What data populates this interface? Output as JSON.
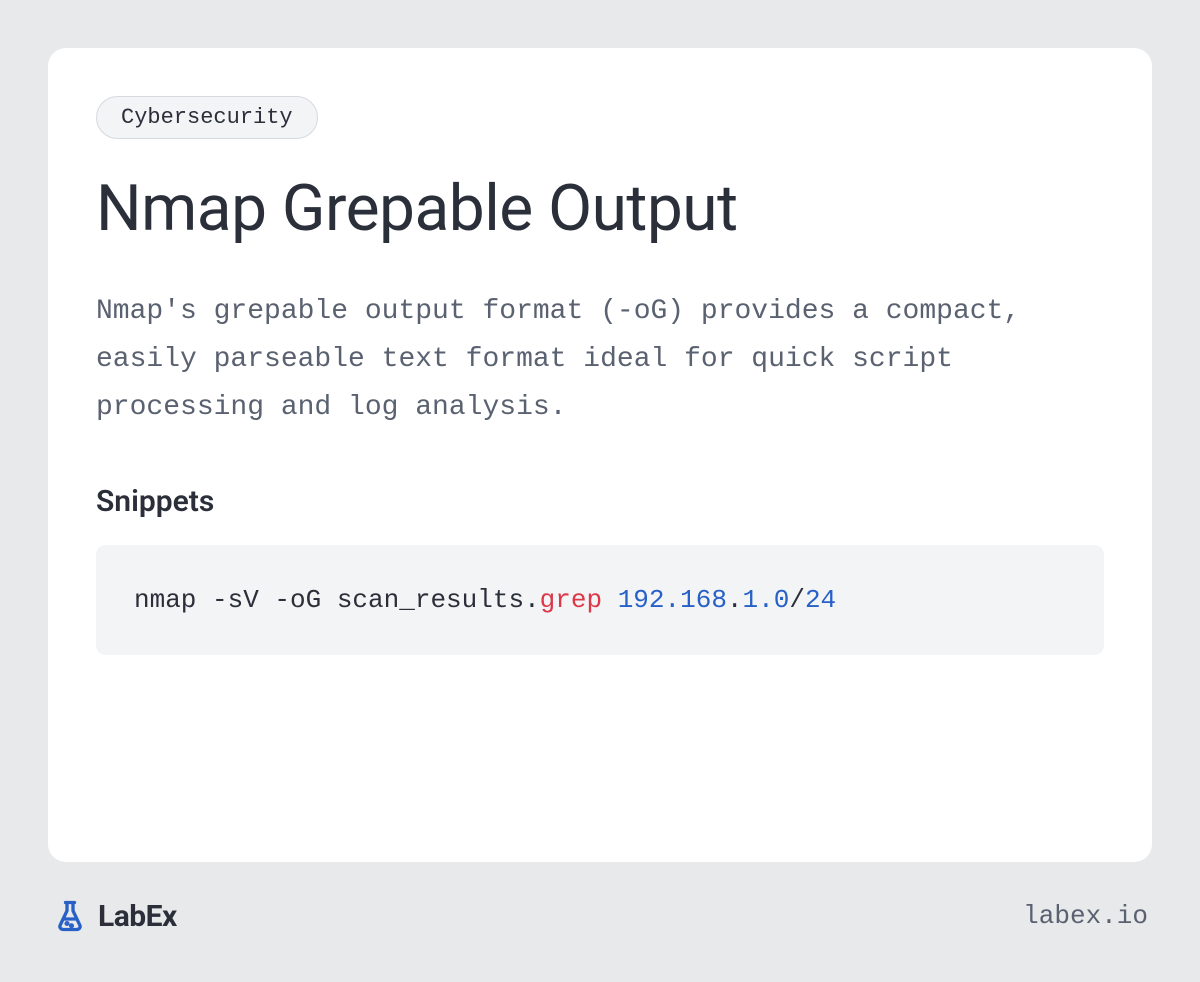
{
  "tag": "Cybersecurity",
  "title": "Nmap Grepable Output",
  "description": "Nmap's grepable output format (-oG) provides a compact, easily parseable text format ideal for quick script processing and log analysis.",
  "snippets_heading": "Snippets",
  "code": {
    "part1": "nmap -sV -oG scan_results.",
    "part2_red": "grep",
    "part3": " ",
    "part4_blue1": "192.168",
    "part5": ".",
    "part6_blue2": "1.0",
    "part7": "/",
    "part8_blue3": "24"
  },
  "brand": {
    "name": "LabEx",
    "url": "labex.io"
  }
}
